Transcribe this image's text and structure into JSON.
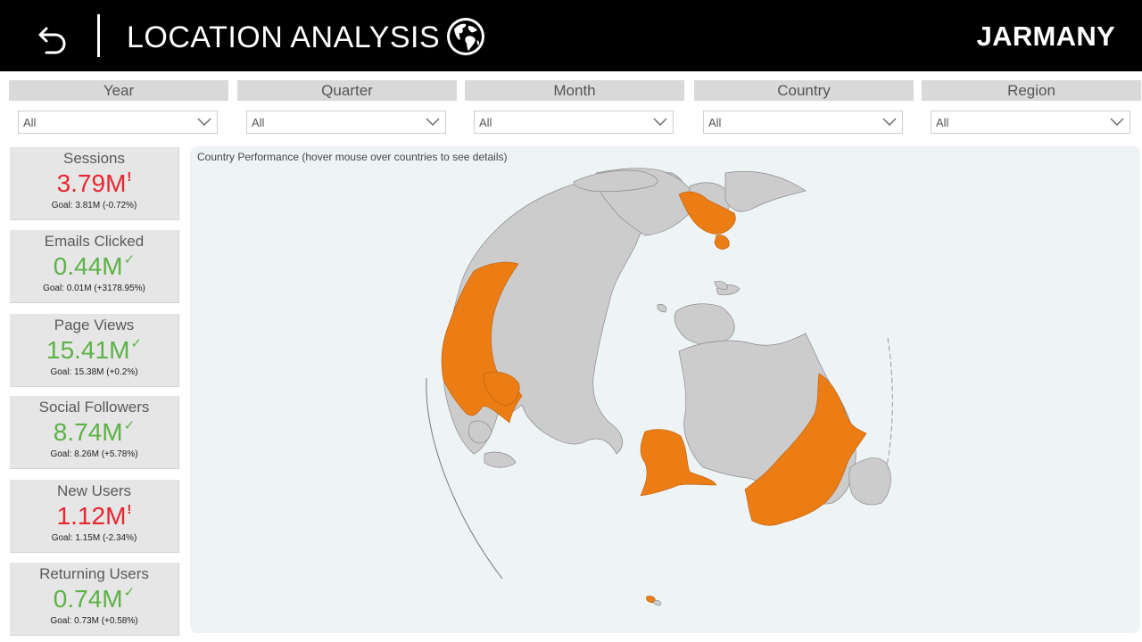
{
  "header": {
    "title": "LOCATION ANALYSIS",
    "brand": "JARMANY",
    "back_icon": "back-arrow-icon",
    "title_icon": "globe-icon"
  },
  "filters": [
    {
      "label": "Year",
      "value": "All"
    },
    {
      "label": "Quarter",
      "value": "All"
    },
    {
      "label": "Month",
      "value": "All"
    },
    {
      "label": "Country",
      "value": "All"
    },
    {
      "label": "Region",
      "value": "All"
    }
  ],
  "kpis": [
    {
      "label": "Sessions",
      "value": "3.79M",
      "indicator": "!",
      "status": "bad",
      "goal": "Goal: 3.81M (-0.72%)"
    },
    {
      "label": "Emails Clicked",
      "value": "0.44M",
      "indicator": "✓",
      "status": "good",
      "goal": "Goal: 0.01M (+3178.95%)"
    },
    {
      "label": "Page Views",
      "value": "15.41M",
      "indicator": "✓",
      "status": "good",
      "goal": "Goal: 15.38M (+0.2%)"
    },
    {
      "label": "Social Followers",
      "value": "8.74M",
      "indicator": "✓",
      "status": "good",
      "goal": "Goal: 8.26M (+5.78%)"
    },
    {
      "label": "New Users",
      "value": "1.12M",
      "indicator": "!",
      "status": "bad",
      "goal": "Goal: 1.15M (-2.34%)"
    },
    {
      "label": "Returning Users",
      "value": "0.74M",
      "indicator": "✓",
      "status": "good",
      "goal": "Goal: 0.73M (+0.58%)"
    }
  ],
  "map": {
    "title": "Country Performance (hover mouse over countries to see details)",
    "land_color": "#cccccc",
    "highlight_color": "#ec7c14",
    "background_color": "#eef4f6"
  },
  "colors": {
    "bad": "#e8262f",
    "good": "#5cb246",
    "header_bg": "#000000"
  }
}
